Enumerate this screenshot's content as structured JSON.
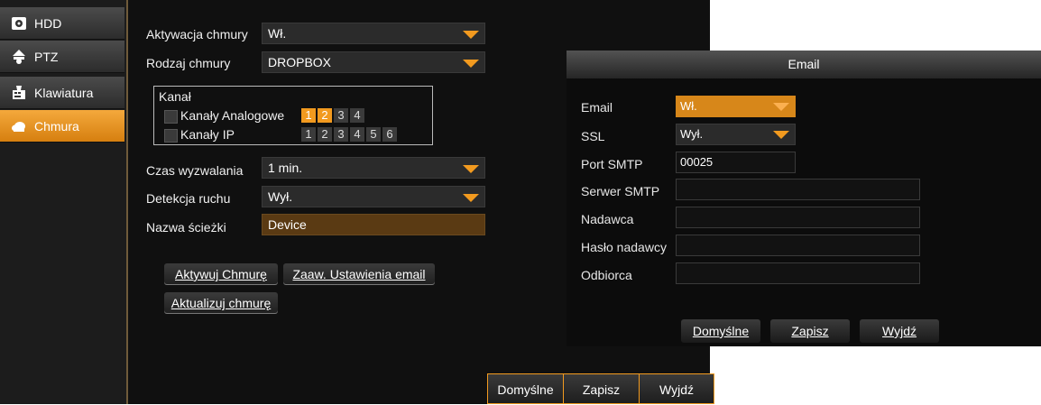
{
  "sidebar": {
    "items": [
      {
        "label": "HDD",
        "icon": "hdd-icon"
      },
      {
        "label": "PTZ",
        "icon": "ptz-camera-icon"
      },
      {
        "label": "Klawiatura",
        "icon": "keyboard-icon"
      },
      {
        "label": "Chmura",
        "icon": "cloud-icon",
        "active": true
      }
    ]
  },
  "form": {
    "cloud_activation": {
      "label": "Aktywacja chmury",
      "value": "Wł."
    },
    "cloud_type": {
      "label": "Rodzaj chmury",
      "value": "DROPBOX"
    },
    "channel": {
      "title": "Kanał",
      "analog_label": "Kanały Analogowe",
      "analog_channels": [
        "1",
        "2",
        "3",
        "4"
      ],
      "analog_selected": [
        "1",
        "2"
      ],
      "ip_label": "Kanały IP",
      "ip_channels": [
        "1",
        "2",
        "3",
        "4",
        "5",
        "6"
      ]
    },
    "trigger_time": {
      "label": "Czas wyzwalania",
      "value": "1 min."
    },
    "motion_detection": {
      "label": "Detekcja ruchu",
      "value": "Wył."
    },
    "path_name": {
      "label": "Nazwa ścieżki",
      "value": "Device"
    },
    "buttons": {
      "activate": "Aktywuj Chmurę",
      "advanced_email": "Zaaw. Ustawienia email",
      "update": "Aktualizuj chmurę"
    }
  },
  "footer": {
    "default": "Domyślne",
    "save": "Zapisz",
    "exit": "Wyjdź"
  },
  "email_dialog": {
    "title": "Email",
    "email": {
      "label": "Email",
      "value": "Wł."
    },
    "ssl": {
      "label": "SSL",
      "value": "Wył."
    },
    "port": {
      "label": "Port SMTP",
      "value": "00025"
    },
    "server": {
      "label": "Serwer SMTP",
      "value": ""
    },
    "sender": {
      "label": "Nadawca",
      "value": ""
    },
    "sender_password": {
      "label": "Hasło nadawcy",
      "value": ""
    },
    "recipient": {
      "label": "Odbiorca",
      "value": ""
    },
    "buttons": {
      "default": "Domyślne",
      "save": "Zapisz",
      "exit": "Wyjdź"
    }
  },
  "colors": {
    "accent": "#f29a1f",
    "active_item": "#e8921f",
    "background": "#101010"
  }
}
